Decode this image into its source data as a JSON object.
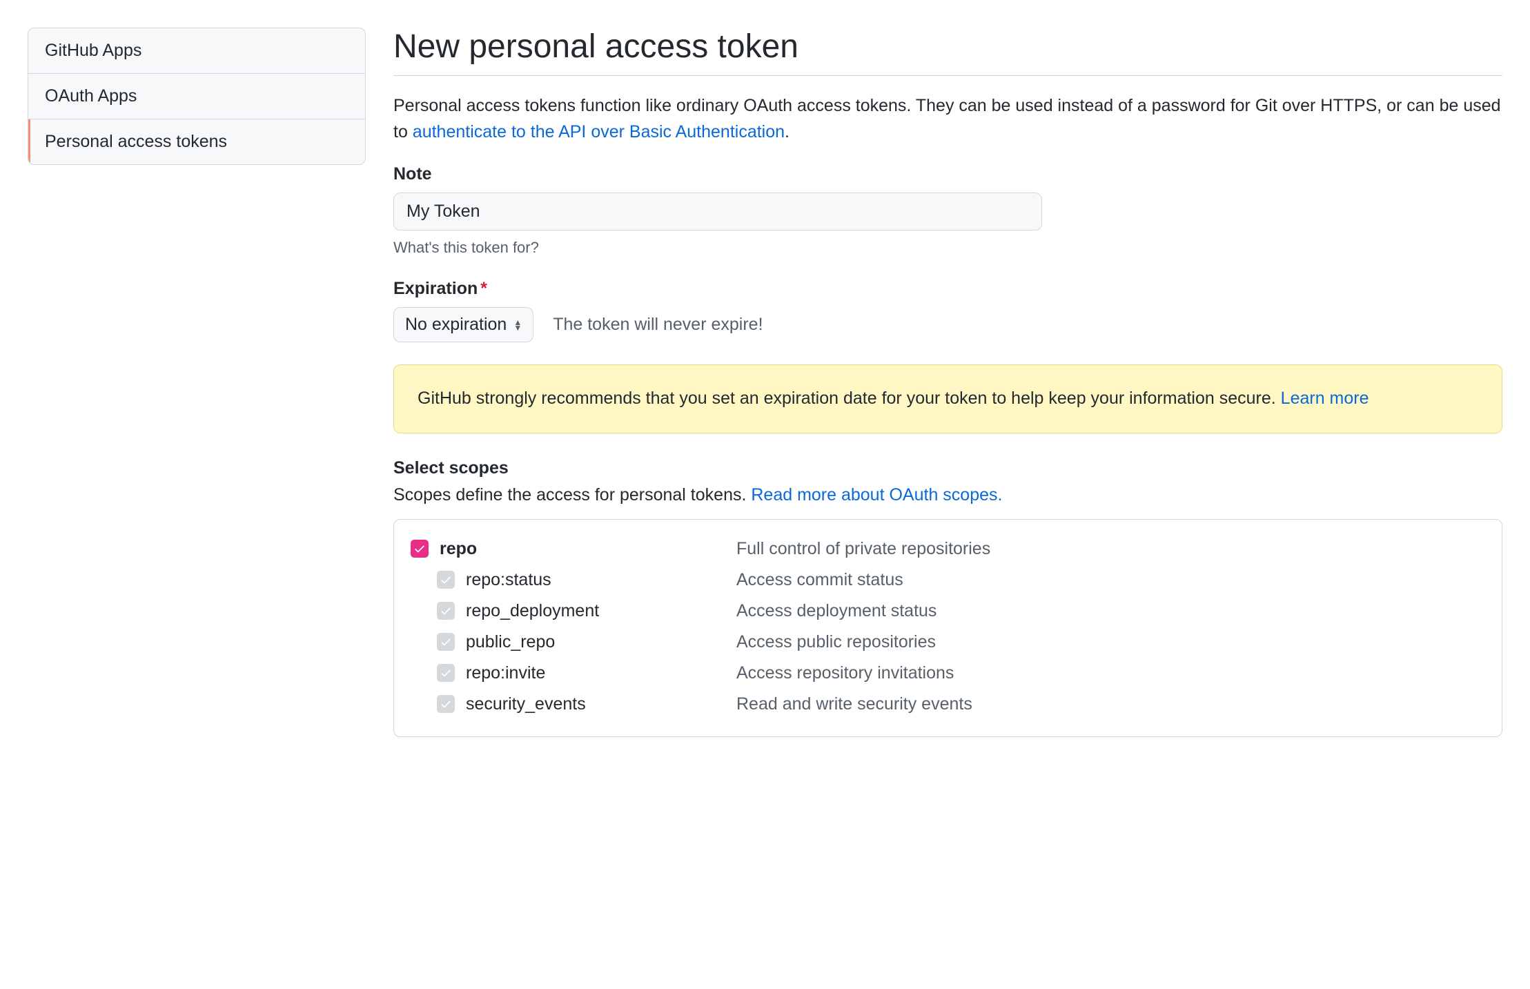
{
  "sidebar": {
    "items": [
      {
        "label": "GitHub Apps",
        "active": false
      },
      {
        "label": "OAuth Apps",
        "active": false
      },
      {
        "label": "Personal access tokens",
        "active": true
      }
    ]
  },
  "header": {
    "title": "New personal access token"
  },
  "intro": {
    "prefix": "Personal access tokens function like ordinary OAuth access tokens. They can be used instead of a password for Git over HTTPS, or can be used to ",
    "link_text": "authenticate to the API over Basic Authentication",
    "suffix": "."
  },
  "note": {
    "label": "Note",
    "value": "My Token",
    "hint": "What's this token for?"
  },
  "expiration": {
    "label": "Expiration",
    "selected": "No expiration",
    "hint": "The token will never expire!"
  },
  "flash": {
    "text": "GitHub strongly recommends that you set an expiration date for your token to help keep your information secure. ",
    "link_text": "Learn more"
  },
  "scopes": {
    "heading": "Select scopes",
    "subtext_prefix": "Scopes define the access for personal tokens. ",
    "subtext_link": "Read more about OAuth scopes.",
    "groups": [
      {
        "name": "repo",
        "description": "Full control of private repositories",
        "checked": true,
        "children": [
          {
            "name": "repo:status",
            "description": "Access commit status",
            "checked": true
          },
          {
            "name": "repo_deployment",
            "description": "Access deployment status",
            "checked": true
          },
          {
            "name": "public_repo",
            "description": "Access public repositories",
            "checked": true
          },
          {
            "name": "repo:invite",
            "description": "Access repository invitations",
            "checked": true
          },
          {
            "name": "security_events",
            "description": "Read and write security events",
            "checked": true
          }
        ]
      }
    ]
  }
}
